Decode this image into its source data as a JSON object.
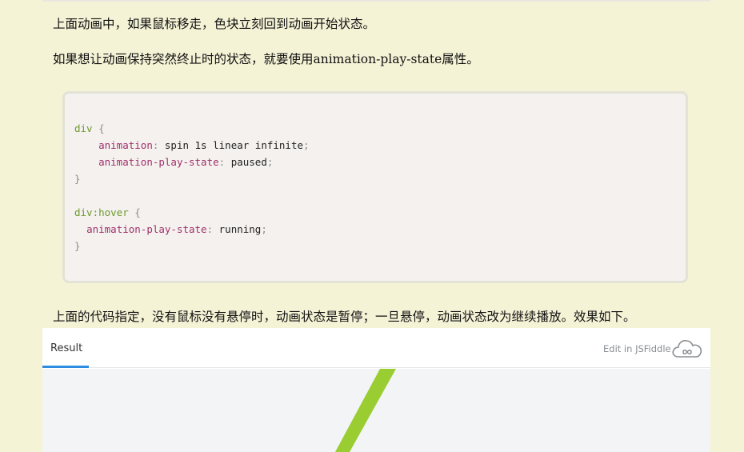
{
  "article": {
    "p1": "上面动画中，如果鼠标移走，色块立刻回到动画开始状态。",
    "p2": "如果想让动画保持突然终止时的状态，就要使用animation-play-state属性。",
    "p3": "上面的代码指定，没有鼠标没有悬停时，动画状态是暂停；一旦悬停，动画状态改为继续播放。效果如下。"
  },
  "code": {
    "sel1": "div",
    "open": "{",
    "close": "}",
    "p_animation": "animation",
    "v_animation": "spin 1s linear infinite",
    "p_state": "animation-play-state",
    "v_paused": "paused",
    "sel2": "div:hover",
    "v_running": "running",
    "colon": ":",
    "semi": ";"
  },
  "fiddle": {
    "tab_label": "Result",
    "edit_label": "Edit in JSFiddle",
    "cloud_icon": "jsfiddle-cloud-icon",
    "accent": "#2e8ce0",
    "bar_color": "#9acd32"
  }
}
